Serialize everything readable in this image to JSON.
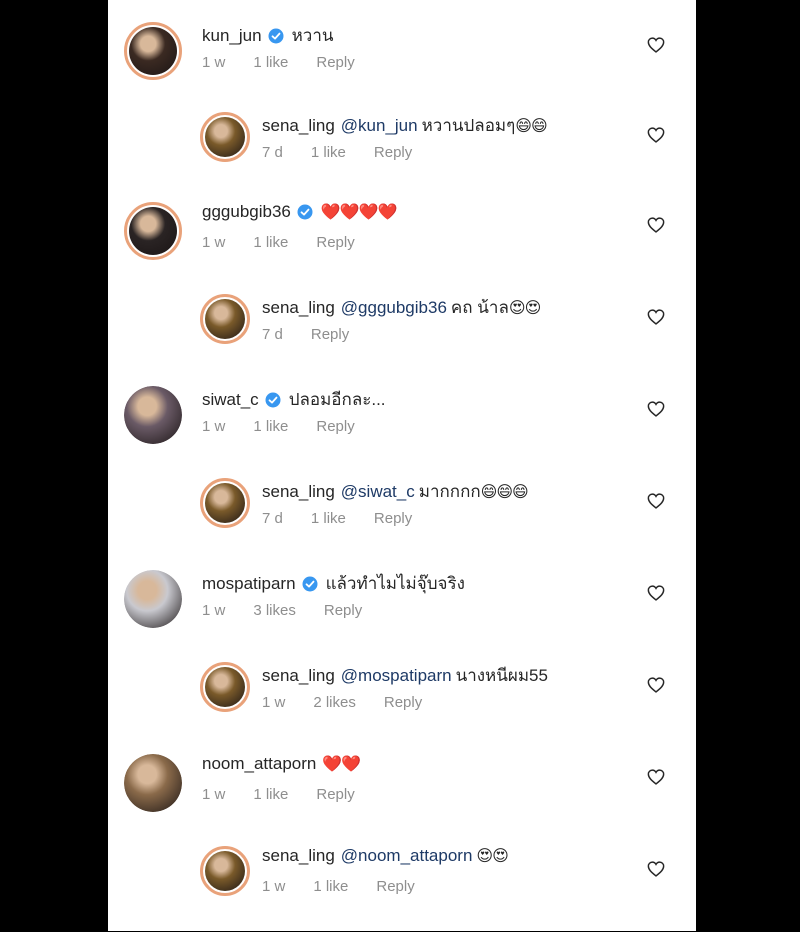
{
  "comments": [
    {
      "user": "kun_jun",
      "verified": true,
      "mention": "",
      "text": "หวาน",
      "emoji": "",
      "time": "1 w",
      "likes": "1 like",
      "reply": "Reply",
      "reply_level": false,
      "ring": true,
      "avatar_color": "#3b2a22"
    },
    {
      "user": "sena_ling",
      "verified": false,
      "mention": "@kun_jun",
      "text": "หวานปลอมๆ",
      "emoji": "😄😄",
      "time": "7 d",
      "likes": "1 like",
      "reply": "Reply",
      "reply_level": true,
      "ring": true,
      "avatar_color": "#7a5a2a"
    },
    {
      "user": "gggubgib36",
      "verified": true,
      "mention": "",
      "text": "",
      "emoji": "❤️❤️❤️❤️",
      "time": "1 w",
      "likes": "1 like",
      "reply": "Reply",
      "reply_level": false,
      "ring": true,
      "avatar_color": "#2a2424"
    },
    {
      "user": "sena_ling",
      "verified": false,
      "mention": "@gggubgib36",
      "text": "คถ น้าล",
      "emoji": "😍😍",
      "time": "7 d",
      "likes": "",
      "reply": "Reply",
      "reply_level": true,
      "ring": true,
      "avatar_color": "#7a5a2a"
    },
    {
      "user": "siwat_c",
      "verified": true,
      "mention": "",
      "text": "ปลอมอีกละ...",
      "emoji": "",
      "time": "1 w",
      "likes": "1 like",
      "reply": "Reply",
      "reply_level": false,
      "ring": false,
      "avatar_color": "#6a5a66"
    },
    {
      "user": "sena_ling",
      "verified": false,
      "mention": "@siwat_c",
      "text": "มากกกก",
      "emoji": "😄😄😄",
      "time": "7 d",
      "likes": "1 like",
      "reply": "Reply",
      "reply_level": true,
      "ring": true,
      "avatar_color": "#7a5a2a"
    },
    {
      "user": "mospatiparn",
      "verified": true,
      "mention": "",
      "text": "แล้วทำไมไม่จุ๊บจริง",
      "emoji": "",
      "time": "1 w",
      "likes": "3 likes",
      "reply": "Reply",
      "reply_level": false,
      "ring": false,
      "avatar_color": "#c9c9cf"
    },
    {
      "user": "sena_ling",
      "verified": false,
      "mention": "@mospatiparn",
      "text": "นางหนีผม55",
      "emoji": "",
      "time": "1 w",
      "likes": "2 likes",
      "reply": "Reply",
      "reply_level": true,
      "ring": true,
      "avatar_color": "#7a5a2a"
    },
    {
      "user": "noom_attaporn",
      "verified": false,
      "mention": "",
      "text": "",
      "emoji": "❤️❤️",
      "time": "1 w",
      "likes": "1 like",
      "reply": "Reply",
      "reply_level": false,
      "ring": false,
      "avatar_color": "#8a6a4a"
    },
    {
      "user": "sena_ling",
      "verified": false,
      "mention": "@noom_attaporn",
      "text": "",
      "emoji": "😍😍",
      "time": "1 w",
      "likes": "1 like",
      "reply": "Reply",
      "reply_level": true,
      "ring": true,
      "avatar_color": "#7a5a2a"
    }
  ],
  "colors": {
    "verified": "#3897f0",
    "mention": "#1e3a66",
    "meta": "#8e8e8e",
    "ring": "#e9a27a"
  },
  "icons": {
    "verified": "verified-badge-icon",
    "like": "heart-outline-icon"
  }
}
